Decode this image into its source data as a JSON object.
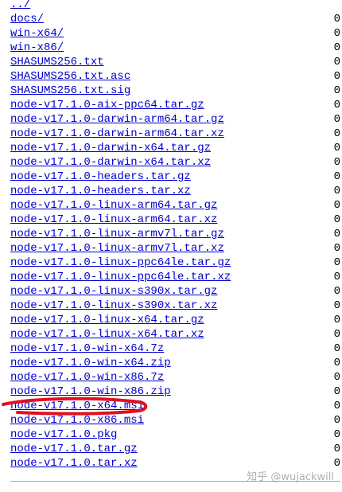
{
  "files": [
    {
      "name": "../",
      "size": ""
    },
    {
      "name": "docs/",
      "size": "0"
    },
    {
      "name": "win-x64/",
      "size": "0"
    },
    {
      "name": "win-x86/",
      "size": "0"
    },
    {
      "name": "SHASUMS256.txt",
      "size": "0"
    },
    {
      "name": "SHASUMS256.txt.asc",
      "size": "0"
    },
    {
      "name": "SHASUMS256.txt.sig",
      "size": "0"
    },
    {
      "name": "node-v17.1.0-aix-ppc64.tar.gz",
      "size": "0"
    },
    {
      "name": "node-v17.1.0-darwin-arm64.tar.gz",
      "size": "0"
    },
    {
      "name": "node-v17.1.0-darwin-arm64.tar.xz",
      "size": "0"
    },
    {
      "name": "node-v17.1.0-darwin-x64.tar.gz",
      "size": "0"
    },
    {
      "name": "node-v17.1.0-darwin-x64.tar.xz",
      "size": "0"
    },
    {
      "name": "node-v17.1.0-headers.tar.gz",
      "size": "0"
    },
    {
      "name": "node-v17.1.0-headers.tar.xz",
      "size": "0"
    },
    {
      "name": "node-v17.1.0-linux-arm64.tar.gz",
      "size": "0"
    },
    {
      "name": "node-v17.1.0-linux-arm64.tar.xz",
      "size": "0"
    },
    {
      "name": "node-v17.1.0-linux-armv7l.tar.gz",
      "size": "0"
    },
    {
      "name": "node-v17.1.0-linux-armv7l.tar.xz",
      "size": "0"
    },
    {
      "name": "node-v17.1.0-linux-ppc64le.tar.gz",
      "size": "0"
    },
    {
      "name": "node-v17.1.0-linux-ppc64le.tar.xz",
      "size": "0"
    },
    {
      "name": "node-v17.1.0-linux-s390x.tar.gz",
      "size": "0"
    },
    {
      "name": "node-v17.1.0-linux-s390x.tar.xz",
      "size": "0"
    },
    {
      "name": "node-v17.1.0-linux-x64.tar.gz",
      "size": "0"
    },
    {
      "name": "node-v17.1.0-linux-x64.tar.xz",
      "size": "0"
    },
    {
      "name": "node-v17.1.0-win-x64.7z",
      "size": "0"
    },
    {
      "name": "node-v17.1.0-win-x64.zip",
      "size": "0"
    },
    {
      "name": "node-v17.1.0-win-x86.7z",
      "size": "0"
    },
    {
      "name": "node-v17.1.0-win-x86.zip",
      "size": "0"
    },
    {
      "name": "node-v17.1.0-x64.msi",
      "size": "0"
    },
    {
      "name": "node-v17.1.0-x86.msi",
      "size": "0"
    },
    {
      "name": "node-v17.1.0.pkg",
      "size": "0"
    },
    {
      "name": "node-v17.1.0.tar.gz",
      "size": "0"
    },
    {
      "name": "node-v17.1.0.tar.xz",
      "size": "0"
    }
  ],
  "watermark": "知乎 @wujackwill",
  "colors": {
    "link": "#0000cc",
    "highlight_stroke": "#e0101e",
    "rule": "#a8a8a8"
  }
}
